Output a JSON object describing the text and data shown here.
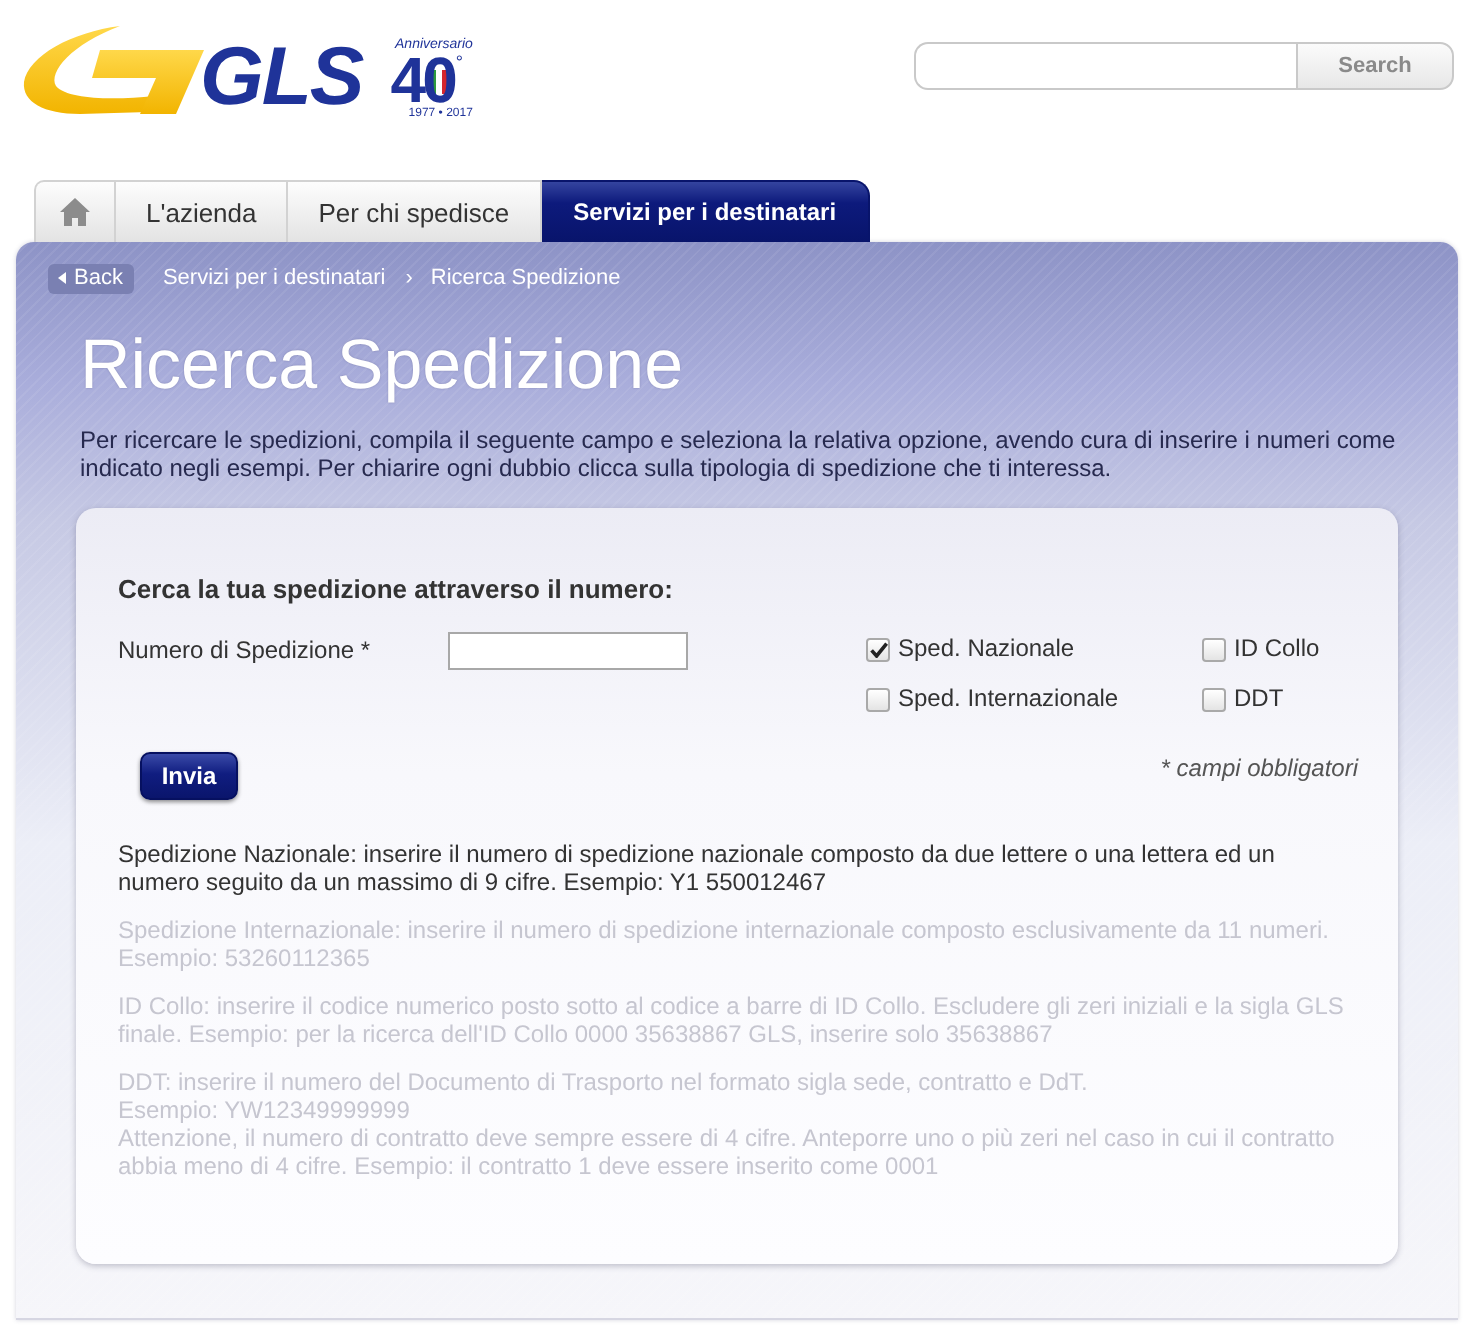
{
  "logo": {
    "wordmark": "GLS",
    "anniversary_caption": "Anniversario",
    "anniversary_number": "40",
    "anniversary_degree": "°",
    "anniversary_years": "1977 • 2017"
  },
  "search": {
    "button": "Search"
  },
  "tabs": [
    {
      "kind": "home",
      "selected": false
    },
    {
      "kind": "text",
      "label": "L'azienda",
      "selected": false
    },
    {
      "kind": "text",
      "label": "Per chi spedisce",
      "selected": false
    },
    {
      "kind": "text",
      "label": "Servizi per i destinatari",
      "selected": true
    }
  ],
  "breadcrumb": {
    "back": "Back",
    "items": [
      "Servizi per i destinatari",
      "Ricerca Spedizione"
    ],
    "separator": "›"
  },
  "title": "Ricerca Spedizione",
  "intro": "Per ricercare le spedizioni, compila il seguente campo e seleziona la relativa opzione, avendo cura di inserire i numeri come indicato negli esempi. Per chiarire ogni dubbio clicca sulla tipologia di spedizione che ti interessa.",
  "form": {
    "heading": "Cerca la tua spedizione attraverso il numero:",
    "field_label": "Numero di Spedizione *",
    "options": [
      {
        "label": "Sped. Nazionale",
        "checked": true
      },
      {
        "label": "ID Collo",
        "checked": false
      },
      {
        "label": "Sped. Internazionale",
        "checked": false
      },
      {
        "label": "DDT",
        "checked": false
      }
    ],
    "submit": "Invia",
    "required_note": "* campi obbligatori"
  },
  "help": [
    {
      "lines": [
        "Spedizione Nazionale: inserire il numero di spedizione nazionale composto da due lettere o una lettera ed un numero seguito da un massimo di 9 cifre. Esempio: Y1 550012467"
      ],
      "active": true
    },
    {
      "lines": [
        "Spedizione Internazionale: inserire il numero di spedizione internazionale composto esclusivamente da 11 numeri. Esempio: 53260112365"
      ],
      "active": false
    },
    {
      "lines": [
        "ID Collo: inserire il codice numerico posto sotto al codice a barre di ID Collo. Escludere gli zeri iniziali e la sigla GLS finale. Esempio: per la ricerca dell'ID Collo 0000 35638867 GLS, inserire solo 35638867"
      ],
      "active": false
    },
    {
      "lines": [
        "DDT: inserire il numero del Documento di Trasporto nel formato sigla sede, contratto e DdT.",
        "Esempio: YW12349999999",
        "Attenzione, il numero di contratto deve sempre essere di 4 cifre. Anteporre uno o più zeri nel caso in cui il contratto abbia meno di 4 cifre. Esempio: il contratto 1 deve essere inserito come 0001"
      ],
      "active": false
    }
  ]
}
